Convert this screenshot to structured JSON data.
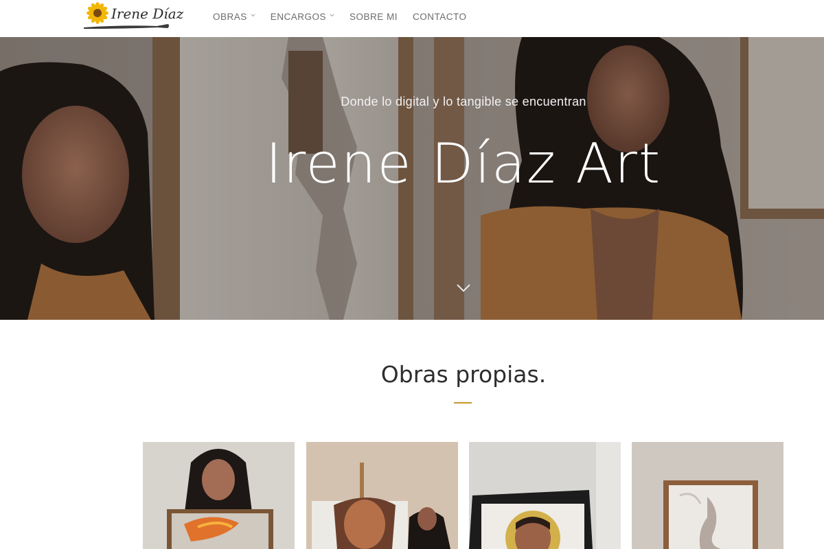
{
  "header": {
    "logo_text": "Irene Díaz",
    "nav": [
      {
        "label": "OBRAS",
        "has_dropdown": true
      },
      {
        "label": "ENCARGOS",
        "has_dropdown": true
      },
      {
        "label": "SOBRE MI",
        "has_dropdown": false
      },
      {
        "label": "CONTACTO",
        "has_dropdown": false
      }
    ]
  },
  "hero": {
    "tagline": "Donde lo digital y lo tangible se encuentran",
    "title": "Irene Díaz Art"
  },
  "section": {
    "title": "Obras propias."
  },
  "colors": {
    "accent": "#c8952f",
    "nav_text": "#6b6b6b",
    "heading": "#2d2d2d"
  }
}
